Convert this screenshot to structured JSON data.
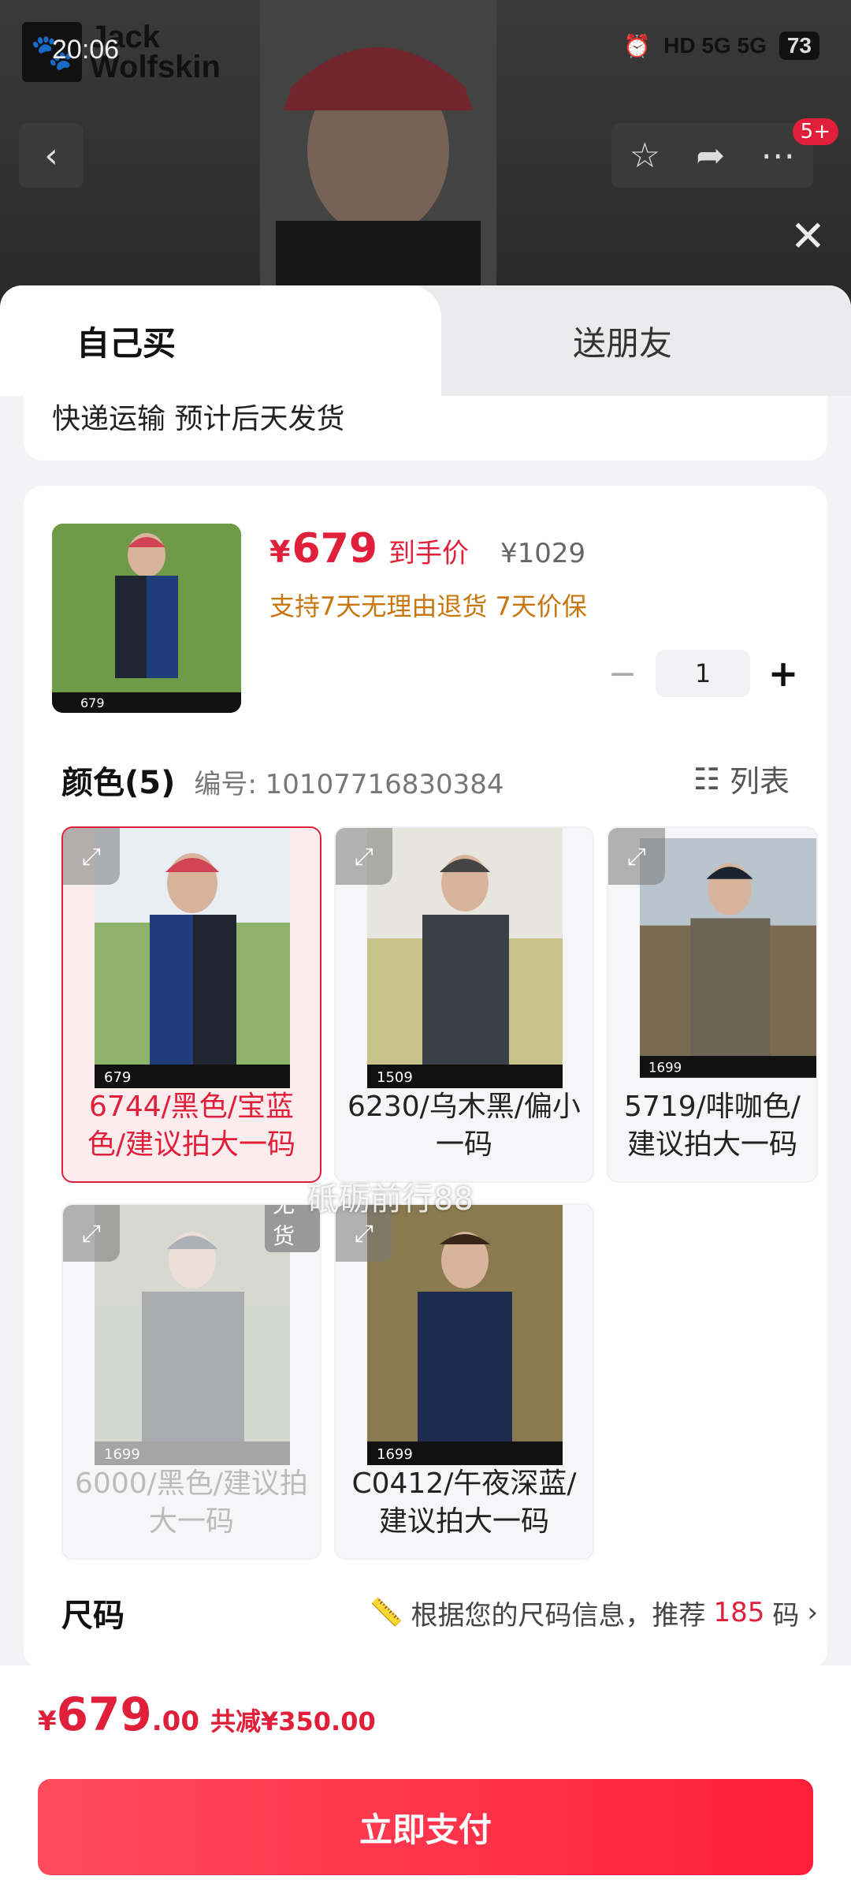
{
  "status_bar": {
    "time": "20:06",
    "network": "HD 5G 5G",
    "battery": "73"
  },
  "brand": {
    "line1": "Jack",
    "line2": "Wolfskin"
  },
  "header": {
    "notify_count": "5+"
  },
  "tabs": [
    {
      "label": "自己买"
    },
    {
      "label": "送朋友"
    }
  ],
  "shipping": {
    "text": "快递运输 预计后天发货"
  },
  "product": {
    "price_symbol": "¥",
    "price": "679",
    "price_label": "到手价",
    "original_price": "¥1029",
    "promises": "支持7天无理由退货 7天价保",
    "quantity": "1",
    "thumb_price": "679"
  },
  "color_section": {
    "title": "颜色(5)",
    "code": "编号: 10107716830384",
    "list_label": "列表",
    "watermark": "砥砺前行88",
    "options": [
      {
        "label": "6744/黑色/宝蓝色/建议拍大一码",
        "price": "679",
        "selected": true,
        "available": true
      },
      {
        "label": "6230/乌木黑/偏小一码",
        "price": "1509",
        "selected": false,
        "available": true
      },
      {
        "label": "5719/啡咖色/建议拍大一码",
        "price": "1699",
        "selected": false,
        "available": true
      },
      {
        "label": "6000/黑色/建议拍大一码",
        "price": "1699",
        "selected": false,
        "available": false,
        "badge": "无货"
      },
      {
        "label": "C0412/午夜深蓝/建议拍大一码",
        "price": "1699",
        "selected": false,
        "available": true
      }
    ]
  },
  "size_section": {
    "title": "尺码",
    "recommend_prefix": "根据您的尺码信息，推荐",
    "recommend_size": "185",
    "recommend_suffix": "码"
  },
  "footer": {
    "total_symbol": "¥",
    "total_int": "679",
    "total_dec": ".00",
    "saved": "共减¥350.00",
    "pay_label": "立即支付"
  },
  "colors": {
    "accent": "#e0203a",
    "promise": "#c8760e"
  }
}
